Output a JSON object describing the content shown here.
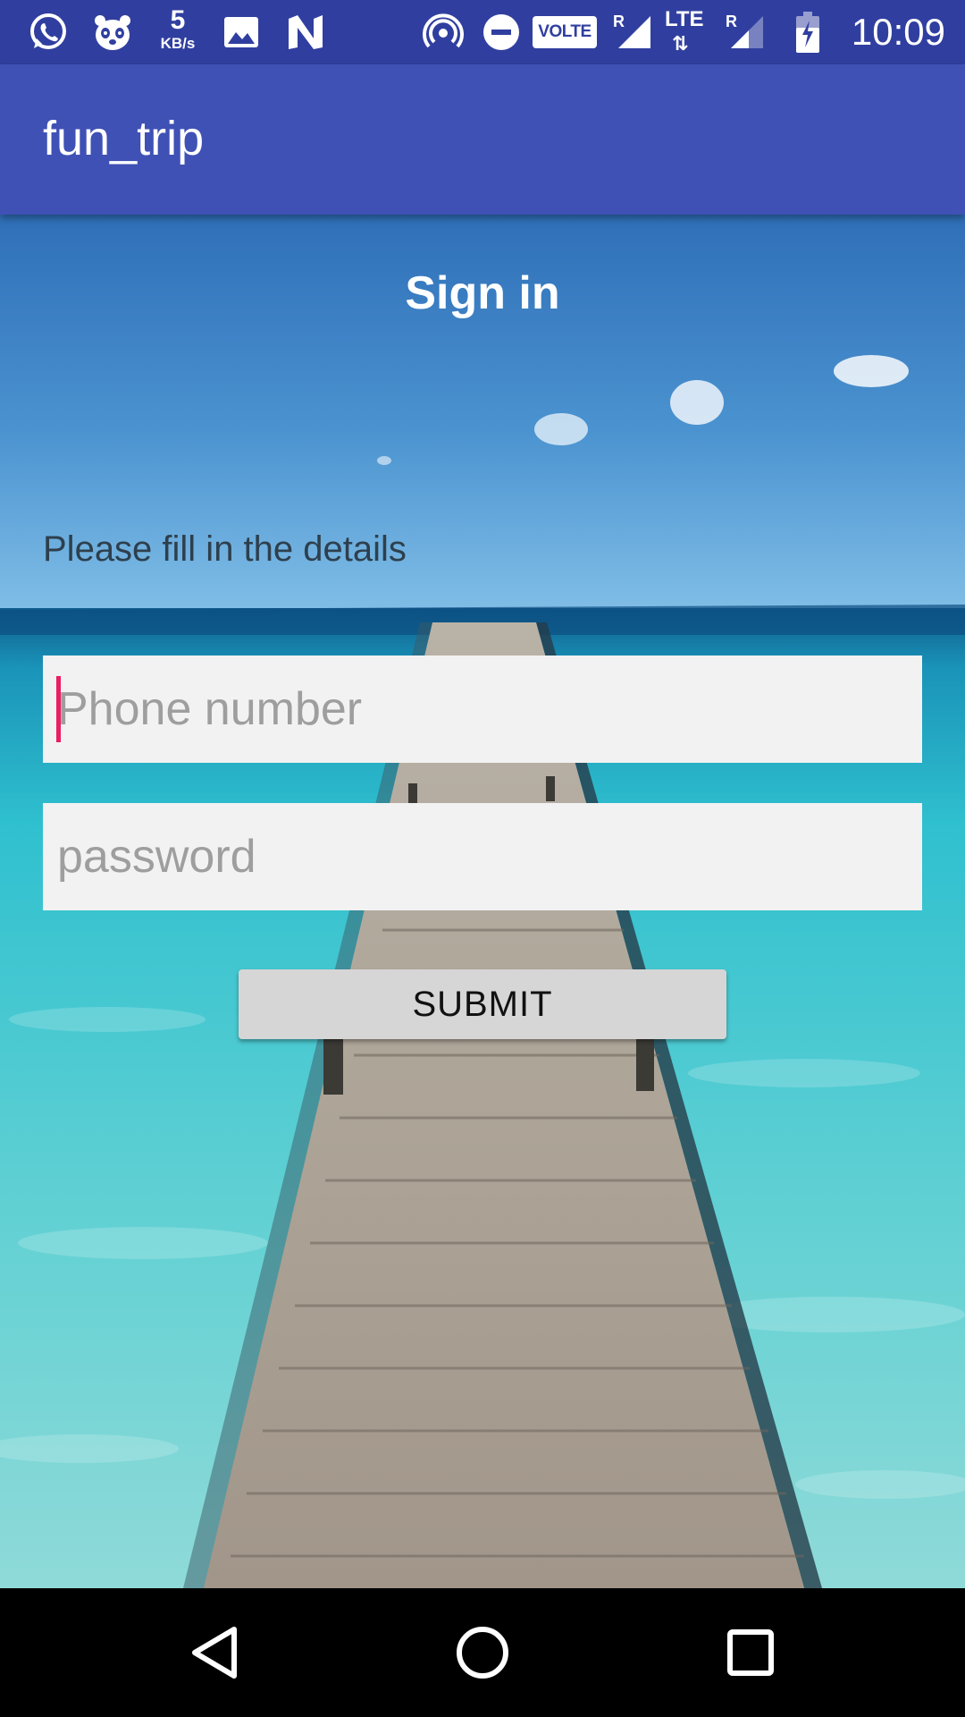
{
  "status_bar": {
    "icons": [
      "whatsapp-icon",
      "panda-icon",
      "image-icon",
      "n-icon",
      "hotspot-icon",
      "dnd-icon",
      "signal-icon",
      "signal-icon",
      "battery-charging-icon"
    ],
    "net_speed_value": "5",
    "net_speed_unit": "KB/s",
    "volte_label": "VOLTE",
    "lte_label": "LTE",
    "roaming_label": "R",
    "time": "10:09"
  },
  "app_bar": {
    "title": "fun_trip",
    "color": "#3f51b5",
    "status_color": "#303f9f"
  },
  "form": {
    "heading": "Sign in",
    "subtitle": "Please fill in the details",
    "phone_placeholder": "Phone number",
    "password_placeholder": "password",
    "submit_label": "SUBMIT",
    "cursor_color": "#e91e63"
  },
  "nav_bar": {
    "icons": [
      "back-icon",
      "home-icon",
      "recents-icon"
    ]
  }
}
